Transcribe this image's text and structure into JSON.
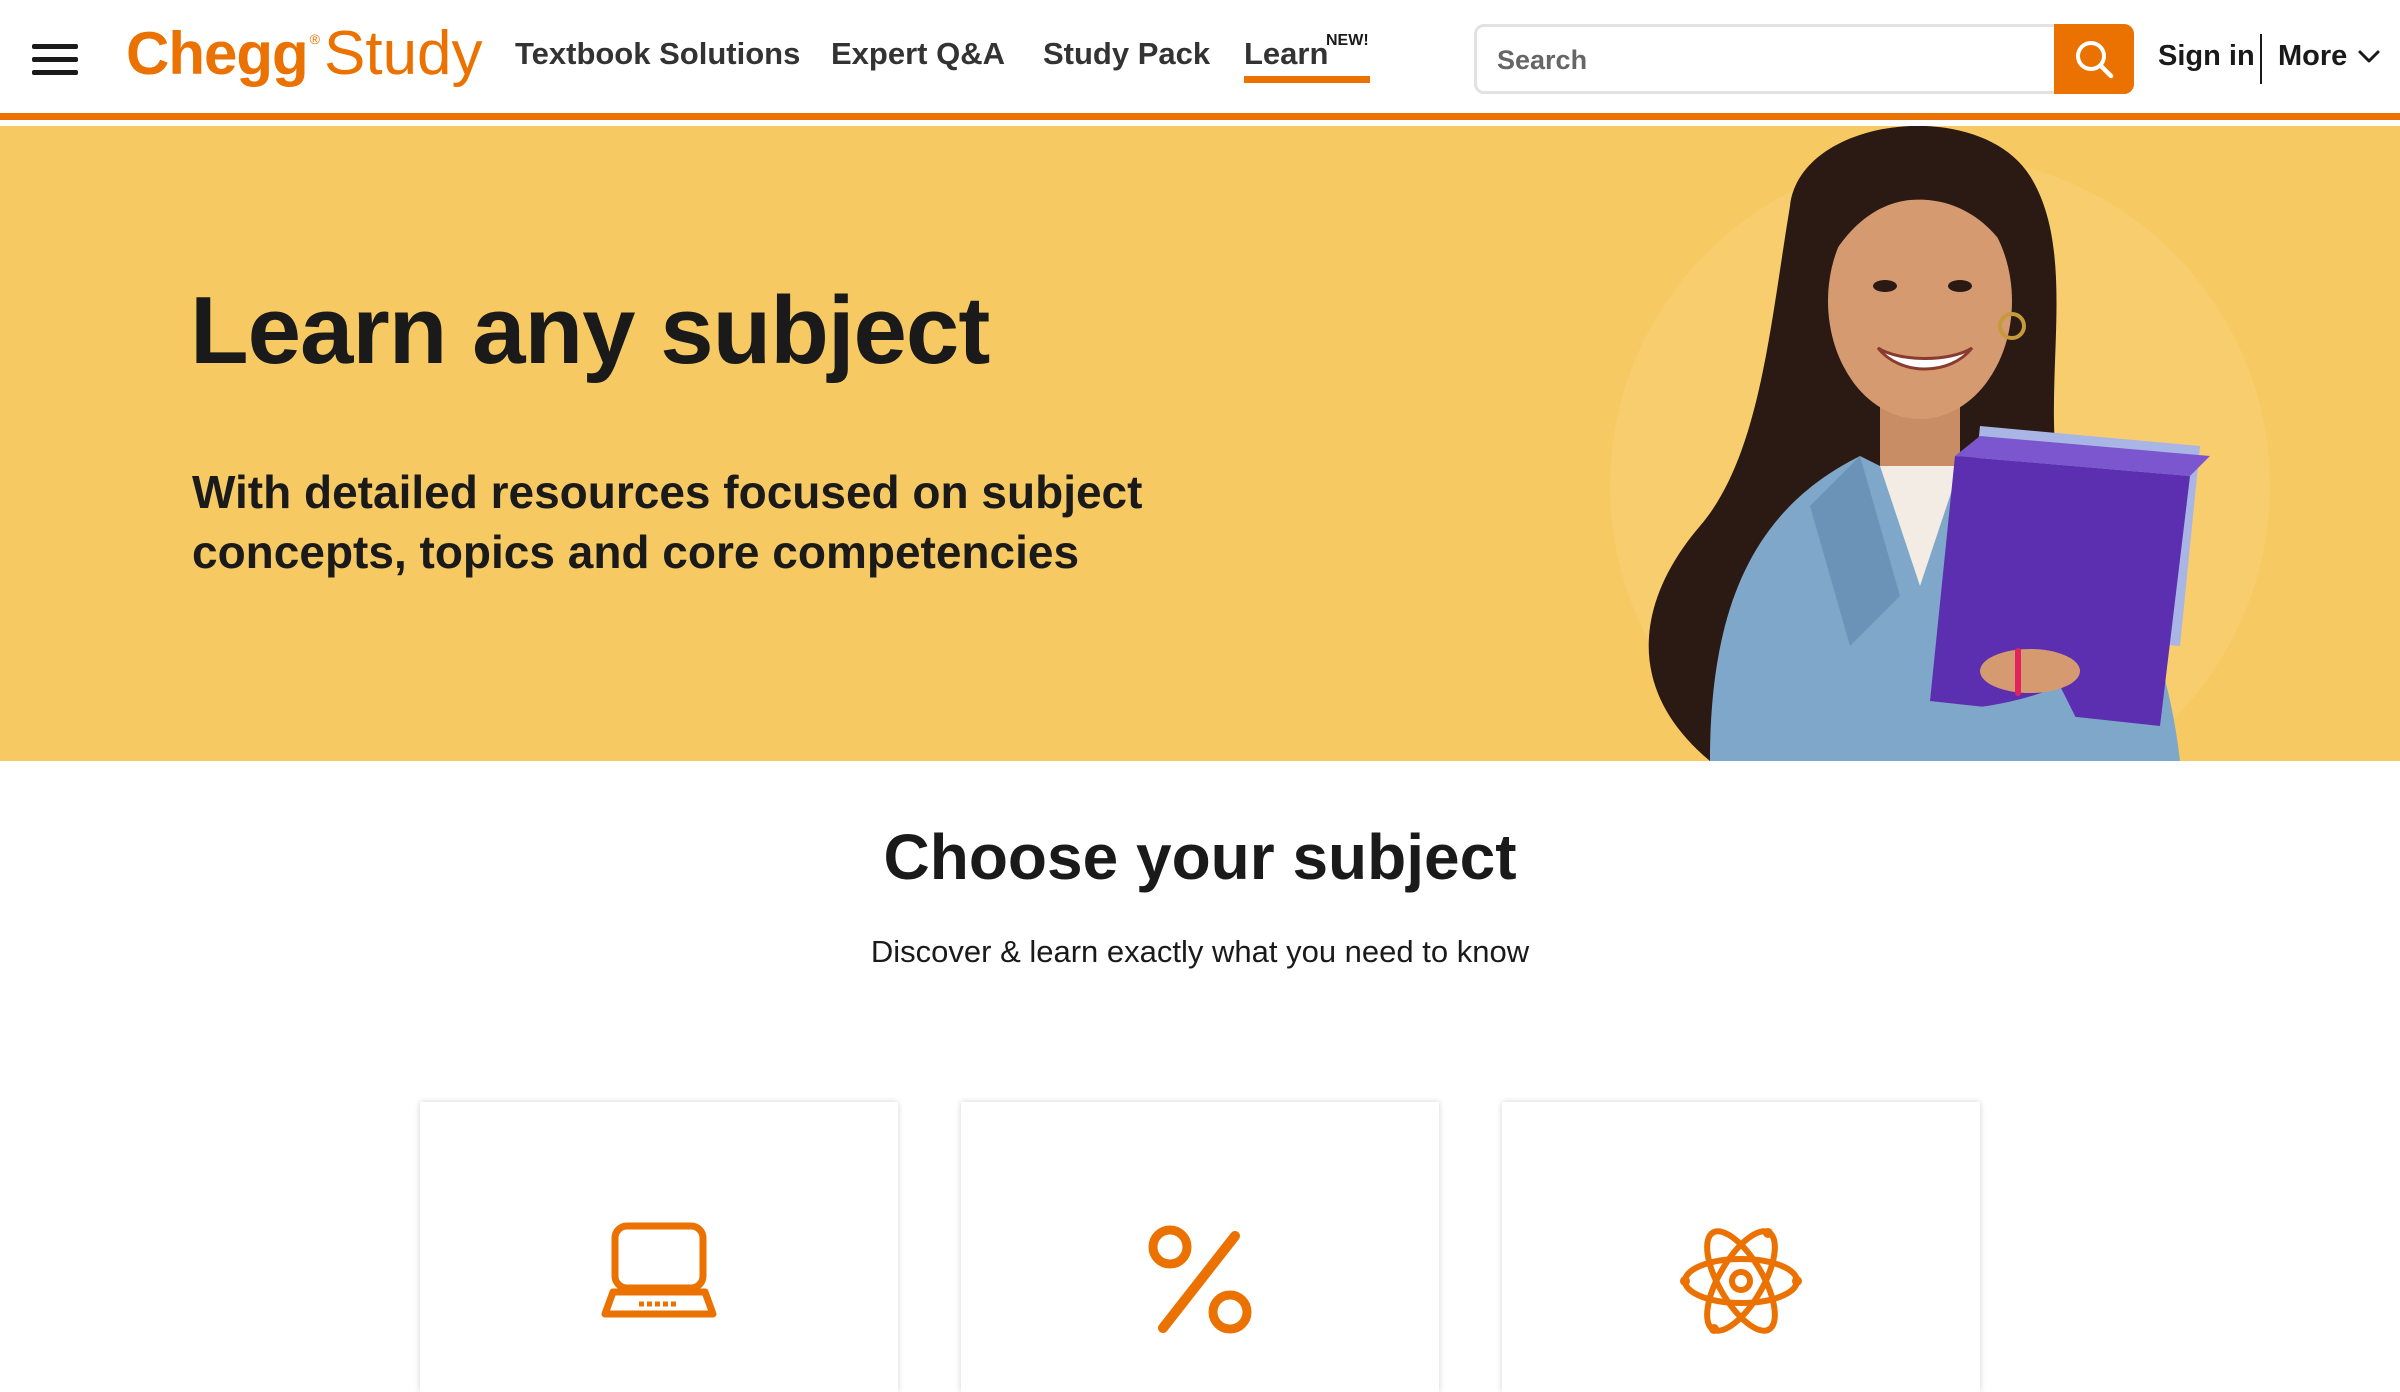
{
  "header": {
    "logo": {
      "brand": "Chegg",
      "reg": "®",
      "product": "Study"
    },
    "nav": [
      {
        "label": "Textbook Solutions"
      },
      {
        "label": "Expert Q&A"
      },
      {
        "label": "Study Pack"
      },
      {
        "label": "Learn",
        "badge": "NEW!",
        "active": true
      }
    ],
    "search": {
      "placeholder": "Search",
      "value": ""
    },
    "sign_in": "Sign in",
    "more": "More"
  },
  "hero": {
    "title": "Learn any subject",
    "subtitle": "With detailed resources focused on subject concepts, topics and core competencies"
  },
  "subjects": {
    "title": "Choose your subject",
    "subtitle": "Discover & learn exactly what you need to know",
    "cards": [
      {
        "icon": "laptop-icon"
      },
      {
        "icon": "percent-icon"
      },
      {
        "icon": "atom-icon"
      }
    ]
  },
  "colors": {
    "accent": "#eb7100",
    "hero_bg": "#f7c962",
    "text": "#1a1a1a"
  }
}
